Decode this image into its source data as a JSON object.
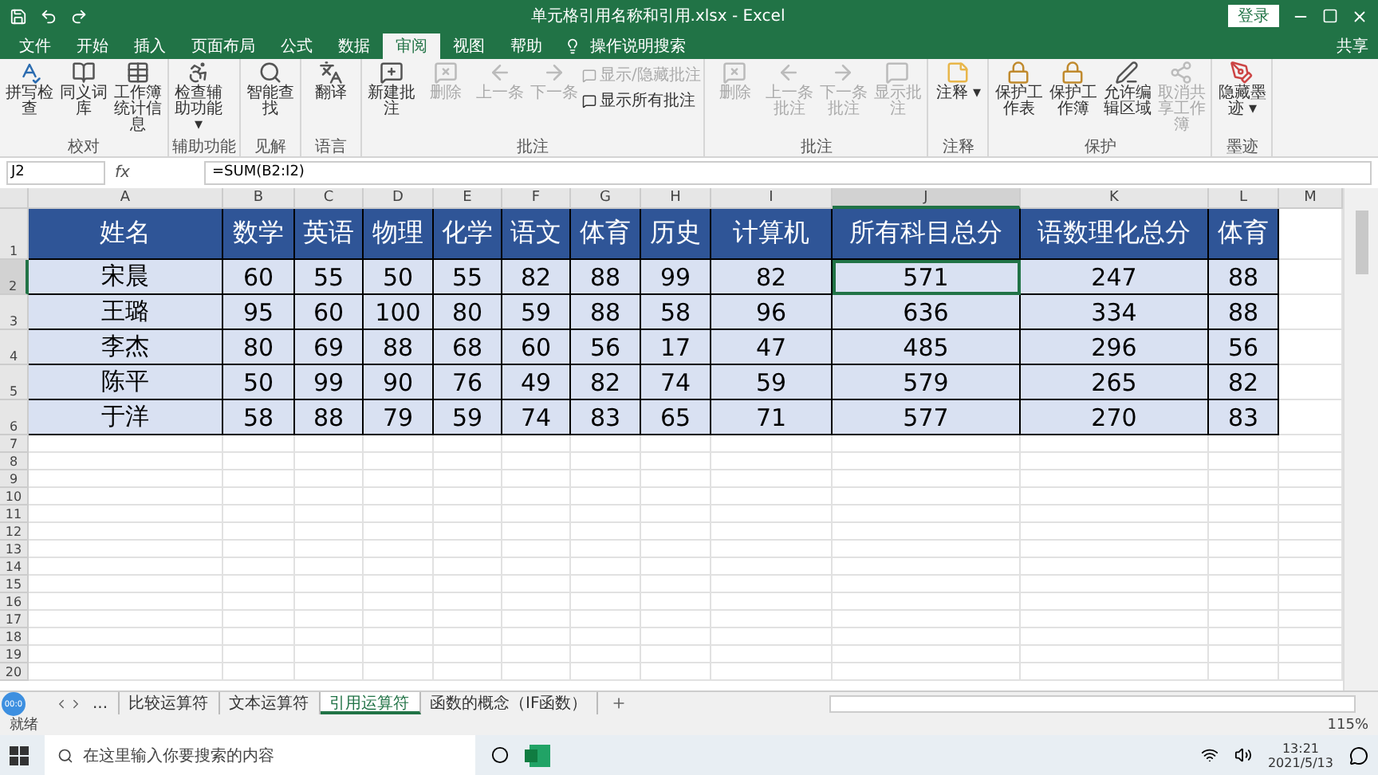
{
  "title_bar": {
    "title": "单元格引用名称和引用.xlsx  -  Excel",
    "login": "登录"
  },
  "menu_tabs": [
    {
      "label": "文件",
      "selected": false
    },
    {
      "label": "开始",
      "selected": false
    },
    {
      "label": "插入",
      "selected": false
    },
    {
      "label": "页面布局",
      "selected": false
    },
    {
      "label": "公式",
      "selected": false
    },
    {
      "label": "数据",
      "selected": false
    },
    {
      "label": "审阅",
      "selected": true
    },
    {
      "label": "视图",
      "selected": false
    },
    {
      "label": "帮助",
      "selected": false
    }
  ],
  "tell_me": "操作说明搜索",
  "share": "共享",
  "ribbon_groups": [
    {
      "label": "校对",
      "buttons": [
        {
          "kind": "large",
          "label": "拼写检查",
          "disabled": false
        },
        {
          "kind": "large",
          "label": "同义词库",
          "disabled": false
        },
        {
          "kind": "large",
          "label": "工作簿统计信息",
          "disabled": false
        }
      ]
    },
    {
      "label": "辅助功能",
      "buttons": [
        {
          "kind": "large",
          "label": "检查辅助功能 ▾",
          "disabled": false
        }
      ]
    },
    {
      "label": "见解",
      "buttons": [
        {
          "kind": "large",
          "label": "智能查找",
          "disabled": false
        }
      ]
    },
    {
      "label": "语言",
      "buttons": [
        {
          "kind": "large",
          "label": "翻译",
          "disabled": false
        }
      ]
    },
    {
      "label": "批注",
      "buttons": [
        {
          "kind": "large",
          "label": "新建批注",
          "disabled": false
        },
        {
          "kind": "large",
          "label": "删除",
          "disabled": true
        },
        {
          "kind": "large",
          "label": "上一条",
          "disabled": true
        },
        {
          "kind": "large",
          "label": "下一条",
          "disabled": true
        },
        {
          "kind": "small",
          "label": "显示/隐藏批注",
          "disabled": true
        },
        {
          "kind": "small",
          "label": "显示所有批注",
          "disabled": false
        }
      ]
    },
    {
      "label": "批注",
      "buttons": [
        {
          "kind": "large",
          "label": "删除",
          "disabled": true
        },
        {
          "kind": "large",
          "label": "上一条批注",
          "disabled": true
        },
        {
          "kind": "large",
          "label": "下一条批注",
          "disabled": true
        },
        {
          "kind": "large",
          "label": "显示批注",
          "disabled": true
        }
      ]
    },
    {
      "label": "注释",
      "buttons": [
        {
          "kind": "large",
          "label": "注释 ▾",
          "disabled": false
        }
      ]
    },
    {
      "label": "保护",
      "buttons": [
        {
          "kind": "large",
          "label": "保护工作表",
          "disabled": false
        },
        {
          "kind": "large",
          "label": "保护工作簿",
          "disabled": false
        },
        {
          "kind": "large",
          "label": "允许编辑区域",
          "disabled": false
        },
        {
          "kind": "large",
          "label": "取消共享工作簿",
          "disabled": true
        }
      ]
    },
    {
      "label": "墨迹",
      "buttons": [
        {
          "kind": "large",
          "label": "隐藏墨迹 ▾",
          "disabled": false
        }
      ]
    }
  ],
  "formula_bar": {
    "name_box": "J2",
    "fx": "fx",
    "formula": "=SUM(B2:I2)"
  },
  "columns": [
    {
      "label": "A",
      "selected": false
    },
    {
      "label": "B",
      "selected": false
    },
    {
      "label": "C",
      "selected": false
    },
    {
      "label": "D",
      "selected": false
    },
    {
      "label": "E",
      "selected": false
    },
    {
      "label": "F",
      "selected": false
    },
    {
      "label": "G",
      "selected": false
    },
    {
      "label": "H",
      "selected": false
    },
    {
      "label": "I",
      "selected": false
    },
    {
      "label": "J",
      "selected": true
    },
    {
      "label": "K",
      "selected": false
    },
    {
      "label": "L",
      "selected": false
    },
    {
      "label": "M",
      "selected": false
    }
  ],
  "rows": [
    {
      "number": "1",
      "selected": false,
      "kind": "header",
      "cells": [
        "姓名",
        "数学",
        "英语",
        "物理",
        "化学",
        "语文",
        "体育",
        "历史",
        "计算机",
        "所有科目总分",
        "语数理化总分",
        "体育"
      ]
    },
    {
      "number": "2",
      "selected": true,
      "kind": "data",
      "cells": [
        "宋晨",
        "60",
        "55",
        "50",
        "55",
        "82",
        "88",
        "99",
        "82",
        "571",
        "247",
        "88"
      ]
    },
    {
      "number": "3",
      "selected": false,
      "kind": "data",
      "cells": [
        "王璐",
        "95",
        "60",
        "100",
        "80",
        "59",
        "88",
        "58",
        "96",
        "636",
        "334",
        "88"
      ]
    },
    {
      "number": "4",
      "selected": false,
      "kind": "data",
      "cells": [
        "李杰",
        "80",
        "69",
        "88",
        "68",
        "60",
        "56",
        "17",
        "47",
        "485",
        "296",
        "56"
      ]
    },
    {
      "number": "5",
      "selected": false,
      "kind": "data",
      "cells": [
        "陈平",
        "50",
        "99",
        "90",
        "76",
        "49",
        "82",
        "74",
        "59",
        "579",
        "265",
        "82"
      ]
    },
    {
      "number": "6",
      "selected": false,
      "kind": "data",
      "cells": [
        "于洋",
        "58",
        "88",
        "79",
        "59",
        "74",
        "83",
        "65",
        "71",
        "577",
        "270",
        "83"
      ]
    },
    {
      "number": "7",
      "selected": false,
      "kind": "empty"
    },
    {
      "number": "8",
      "selected": false,
      "kind": "empty"
    },
    {
      "number": "9",
      "selected": false,
      "kind": "empty"
    },
    {
      "number": "10",
      "selected": false,
      "kind": "empty"
    },
    {
      "number": "11",
      "selected": false,
      "kind": "empty"
    },
    {
      "number": "12",
      "selected": false,
      "kind": "empty"
    },
    {
      "number": "13",
      "selected": false,
      "kind": "empty"
    },
    {
      "number": "14",
      "selected": false,
      "kind": "empty"
    },
    {
      "number": "15",
      "selected": false,
      "kind": "empty"
    },
    {
      "number": "16",
      "selected": false,
      "kind": "empty"
    },
    {
      "number": "17",
      "selected": false,
      "kind": "empty"
    },
    {
      "number": "18",
      "selected": false,
      "kind": "empty"
    },
    {
      "number": "19",
      "selected": false,
      "kind": "empty"
    },
    {
      "number": "20",
      "selected": false,
      "kind": "empty"
    }
  ],
  "sheet_tabs": [
    {
      "label": "...",
      "selected": false
    },
    {
      "label": "比较运算符",
      "selected": false
    },
    {
      "label": "文本运算符",
      "selected": false
    },
    {
      "label": "引用运算符",
      "selected": true
    },
    {
      "label": "函数的概念（IF函数）",
      "selected": false
    }
  ],
  "recorder_badge": "00:0",
  "status": "就绪",
  "zoom": "115%",
  "taskbar": {
    "search_placeholder": "在这里输入你要搜索的内容",
    "time": "13:21",
    "date": "2021/5/13"
  }
}
